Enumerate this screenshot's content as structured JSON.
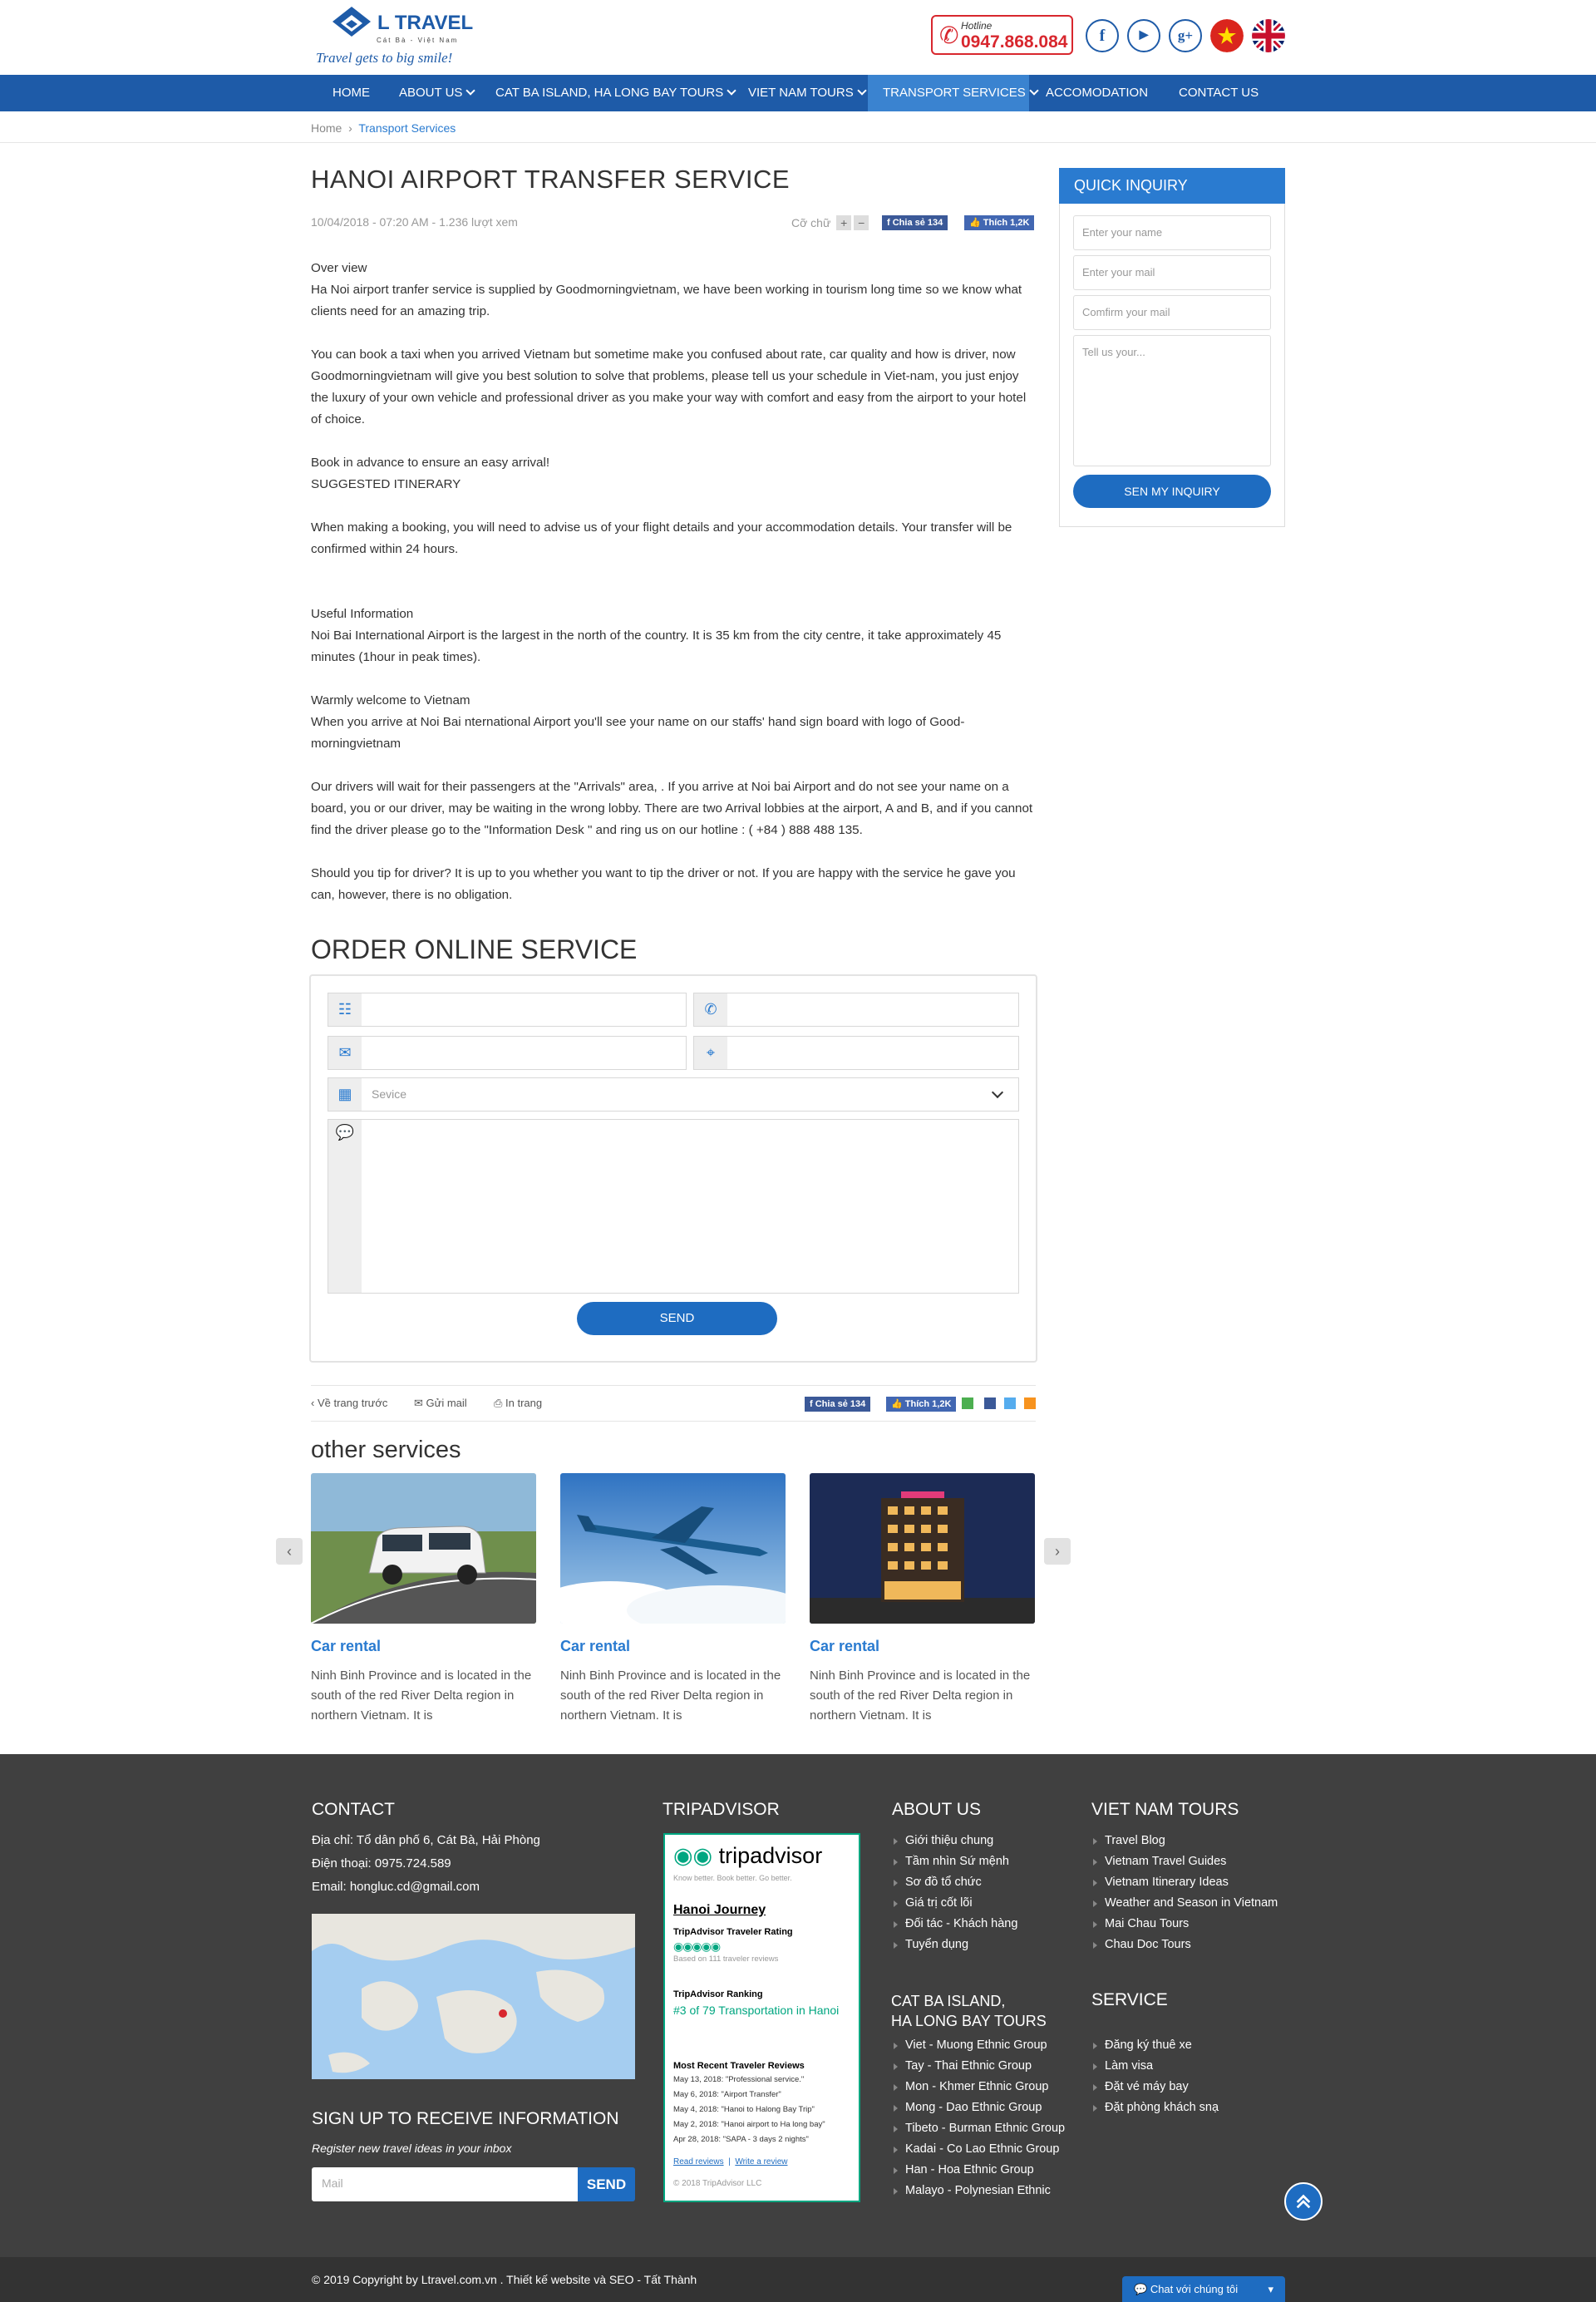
{
  "header": {
    "logo_text": "L TRAVEL",
    "logo_sub": "Cát Bà - Việt Nam",
    "slogan": "Travel gets to big smile!",
    "hotline_label": "Hotline",
    "hotline_number": "0947.868.084",
    "social": [
      {
        "name": "facebook-icon",
        "glyph": "f"
      },
      {
        "name": "youtube-icon",
        "glyph": "▶"
      },
      {
        "name": "google-plus-icon",
        "glyph": "g+"
      }
    ]
  },
  "nav": {
    "items": [
      {
        "label": "HOME"
      },
      {
        "label": "ABOUT US"
      },
      {
        "label": "CAT BA ISLAND, HA LONG BAY TOURS"
      },
      {
        "label": "VIET NAM TOURS"
      },
      {
        "label": "TRANSPORT SERVICES"
      },
      {
        "label": "ACCOMODATION"
      },
      {
        "label": "CONTACT US"
      }
    ]
  },
  "breadcrumb": {
    "home": "Home",
    "sep": "›",
    "current": "Transport Services"
  },
  "article": {
    "title": "HANOI AIRPORT TRANSFER SERVICE",
    "meta": "10/04/2018 - 07:20 AM  -  1.236 lượt xem",
    "font_label": "Cỡ chữ",
    "font_plus": "+",
    "font_minus": "−",
    "share_label": "Chia sẻ  134",
    "like_label": "Thích  1,2K",
    "paragraphs": [
      "Over view",
      "Ha Noi airport tranfer service is supplied by Goodmorningvietnam,  we have been working in tourism long time so we know what clients need for an amazing trip.",
      "",
      "You can book a taxi when you arrived Vietnam but sometime make you confused about rate, car quality and how is driver, now Goodmorningvietnam will give you best solution to solve that problems, please tell us your schedule in Viet-nam, you just enjoy the luxury of your own vehicle and professional driver as you make your way with comfort and easy from the airport to your hotel of choice.",
      "",
      "Book in advance to ensure an easy arrival!",
      "SUGGESTED ITINERARY",
      "",
      "When making a booking, you will need to advise us of your flight details and your accommodation details. Your transfer will be confirmed within 24 hours.",
      "",
      "",
      " Useful Information",
      "Noi Bai International Airport is the largest in the north of the country. It is 35 km from the city centre, it take  approximately 45 minutes (1hour in peak times).",
      "",
      "Warmly welcome  to Vietnam",
      "When you arrive at  Noi Bai nternational Airport you'll see your name on our staffs' hand sign board with logo of Good-morningvietnam",
      "",
      "Our drivers will wait for their passengers at the \"Arrivals\" area, . If you arrive at Noi bai Airport and do not see your name on a board, you or our driver, may be waiting in the wrong lobby. There are two Arrival lobbies at the airport, A and B, and if you cannot find the driver please go to the \"Information Desk \" and ring us on our hotline : ( +84 ) 888 488 135.",
      "",
      "Should you tip for driver? It is up to you whether you want to tip the driver or not. If you are happy with the service he gave you can, however, there is no obligation."
    ]
  },
  "order": {
    "title": "ORDER ONLINE SERVICE",
    "service_placeholder": "Sevice",
    "send": "SEND"
  },
  "sharebar": {
    "back": "Về trang trước",
    "mail": "Gửi mail",
    "print": "In trang",
    "share_label": "Chia sẻ  134",
    "like_label": "Thích  1,2K"
  },
  "other": {
    "title": "other services",
    "cards": [
      {
        "title": "Car rental",
        "text": "Ninh Binh Province and is located in the south of the red River Delta region in northern Vietnam. It is"
      },
      {
        "title": "Car rental",
        "text": "Ninh Binh Province and is located in the south of the red River Delta region in northern Vietnam. It is"
      },
      {
        "title": "Car rental",
        "text": "Ninh Binh Province and is located in the south of the red River Delta region in northern Vietnam. It is"
      }
    ]
  },
  "sidebar": {
    "title": "QUICK INQUIRY",
    "name_ph": "Enter your name",
    "mail_ph": "Enter your mail",
    "confirm_ph": "Comfirm your mail",
    "msg_ph": "Tell us your...",
    "send": "SEN MY INQUIRY"
  },
  "footer": {
    "contact_title": "CONTACT",
    "address": "Địa chỉ: Tổ dân phố 6, Cát Bà, Hải Phòng",
    "phone": "Điện thoại: 0975.724.589",
    "email": "Email: hongluc.cd@gmail.com",
    "signup_title": "SIGN UP TO RECEIVE INFORMATION",
    "signup_sub": "Register new travel ideas in your inbox",
    "mail_ph": "Mail",
    "send": "SEND",
    "trip_title": "TRIPADVISOR",
    "about_title": "ABOUT US",
    "about_items": [
      "Giới thiệu chung",
      "Tầm nhìn Sứ mệnh",
      "Sơ đồ tổ chức",
      "Giá trị cốt lõi",
      "Đối tác - Khách hàng",
      "Tuyển dụng"
    ],
    "catba_title_1": "CAT BA ISLAND,",
    "catba_title_2": "HA LONG BAY TOURS",
    "catba_items": [
      "Viet - Muong Ethnic Group",
      "Tay - Thai Ethnic Group",
      "Mon - Khmer Ethnic Group",
      "Mong - Dao Ethnic Group",
      "Tibeto - Burman Ethnic Group",
      "Kadai - Co Lao Ethnic Group",
      "Han - Hoa Ethnic Group",
      "Malayo - Polynesian Ethnic"
    ],
    "vn_title": "VIET NAM TOURS",
    "vn_items": [
      "Travel Blog",
      "Vietnam Travel Guides",
      "Vietnam Itinerary Ideas",
      "Weather and Season in Vietnam",
      "Mai Chau Tours",
      "Chau Doc Tours"
    ],
    "service_title": "SERVICE",
    "service_items": [
      "Đăng ký thuê xe",
      "Làm visa",
      "Đặt vé máy bay",
      "Đặt phòng khách snạ"
    ],
    "copyright": "© 2019 Copyright by Ltravel.com.vn . Thiết kế website và SEO - Tất Thành",
    "chat": "Chat với chúng tôi"
  },
  "tripadvisor": {
    "brand": "tripadvisor",
    "tagline": "Know better. Book better. Go better.",
    "biz": "Hanoi Journey",
    "rating_label": "TripAdvisor Traveler Rating",
    "based": "Based on 111 traveler reviews",
    "rank_label": "TripAdvisor Ranking",
    "rank_text": "#3 of 79 Transportation in Hanoi",
    "recent_label": "Most Recent Traveler Reviews",
    "reviews": [
      "May 13, 2018: \"Professional service.\"",
      "May 6, 2018: \"Airport Transfer\"",
      "May 4, 2018: \"Hanoi to Halong Bay Trip\"",
      "May 2, 2018: \"Hanoi airport to Ha long bay\"",
      "Apr 28, 2018: \"SAPA - 3 days 2 nights\""
    ],
    "read": "Read reviews",
    "write": "Write a review",
    "copy": "© 2018 TripAdvisor LLC"
  }
}
